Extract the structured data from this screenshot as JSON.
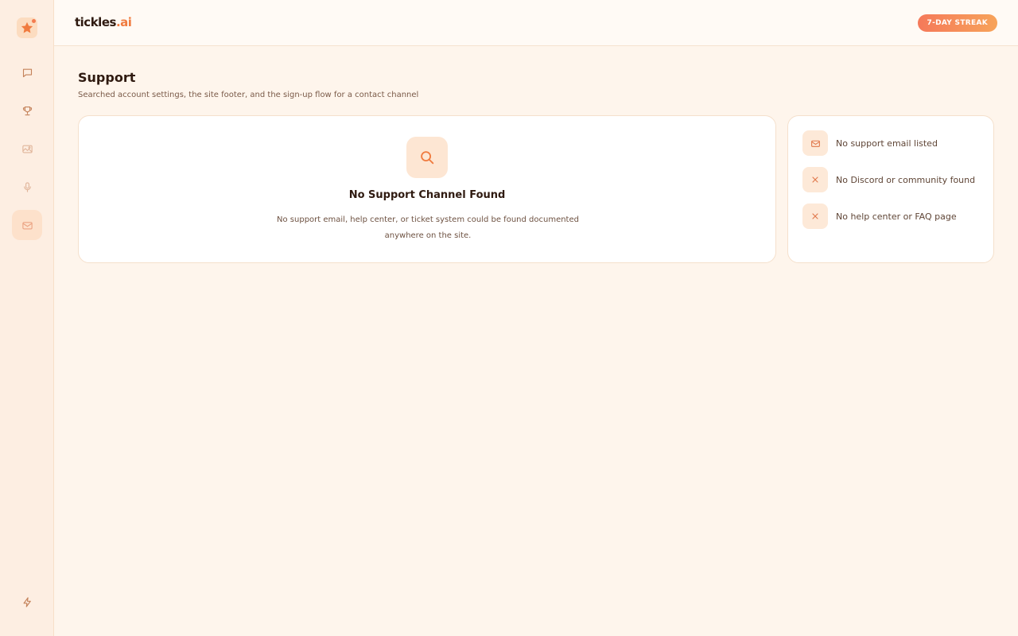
{
  "app": {
    "brand_main": "tickles",
    "brand_accent": ".ai",
    "streak_badge": "7-DAY STREAK"
  },
  "sidebar": {
    "items": [
      {
        "name": "chat",
        "icon": "chat-bubble-icon"
      },
      {
        "name": "trophy",
        "icon": "trophy-icon"
      },
      {
        "name": "gallery",
        "icon": "image-icon"
      },
      {
        "name": "voice",
        "icon": "microphone-icon"
      },
      {
        "name": "support",
        "icon": "mail-icon",
        "active": true
      }
    ],
    "bottom_icon": "lightning-icon"
  },
  "page": {
    "title": "Support",
    "subtitle": "Searched account settings, the site footer, and the sign-up flow for a contact channel"
  },
  "empty_state": {
    "icon": "search-icon",
    "title": "No Support Channel Found",
    "description": "No support email, help center, or ticket system could be found documented anywhere on the site."
  },
  "checks": [
    {
      "icon": "mail-icon",
      "label": "No support email listed"
    },
    {
      "icon": "close-icon",
      "label": "No Discord or community found"
    },
    {
      "icon": "close-icon",
      "label": "No help center or FAQ page"
    }
  ],
  "colors": {
    "accent": "#f07b3f",
    "background": "#fef5ec",
    "sidebar": "#fdeee2",
    "tile": "#fde6d3",
    "streak_start": "#f5795a",
    "streak_end": "#f7a35a"
  }
}
